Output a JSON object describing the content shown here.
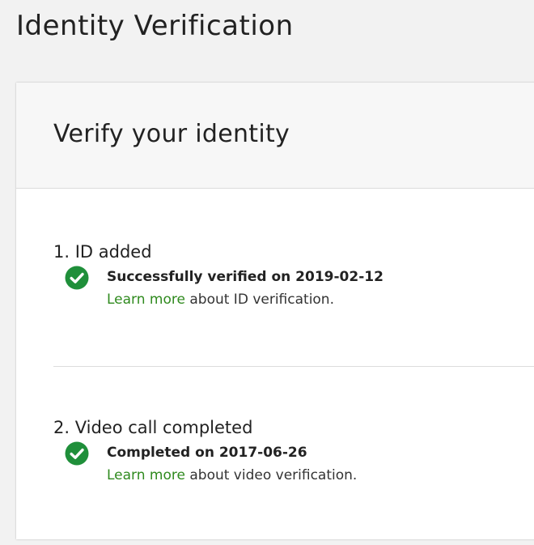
{
  "page": {
    "title": "Identity Verification"
  },
  "card": {
    "title": "Verify your identity"
  },
  "steps": [
    {
      "title": "1. ID added",
      "status": "Successfully verified on 2019-02-12",
      "link_text": "Learn more",
      "link_suffix": " about ID verification.",
      "icon": "check-circle-icon"
    },
    {
      "title": "2. Video call completed",
      "status": "Completed on 2017-06-26",
      "link_text": "Learn more",
      "link_suffix": " about video verification.",
      "icon": "check-circle-icon"
    }
  ],
  "colors": {
    "success": "#1f8f3a",
    "link": "#2f8a1e",
    "background": "#f2f2f2"
  }
}
